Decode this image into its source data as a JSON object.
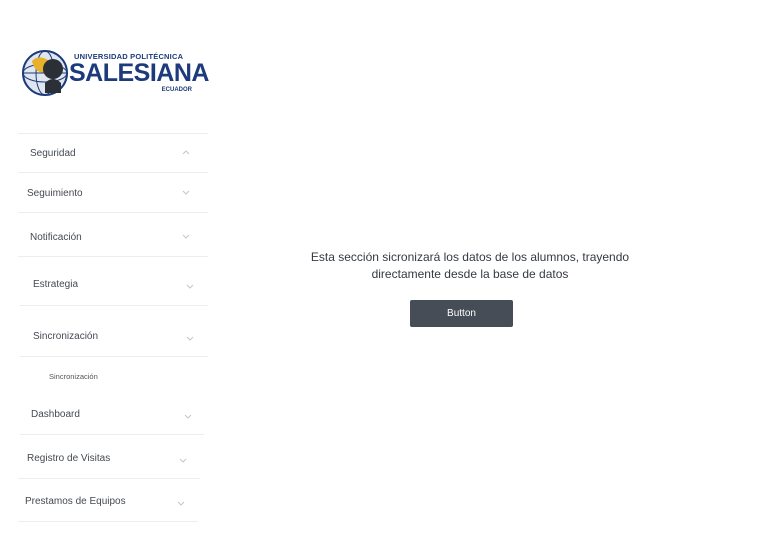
{
  "logo": {
    "line1": "UNIVERSIDAD POLITÉCNICA",
    "line2": "SALESIANA",
    "line3": "ECUADOR"
  },
  "sidebar": {
    "items": [
      {
        "label": "Seguridad",
        "chevron": "chevron-up"
      },
      {
        "label": "Seguimiento",
        "chevron": "chevron-down"
      },
      {
        "label": "Notificación",
        "chevron": "chevron-down"
      },
      {
        "label": "Estrategia",
        "chevron": "chevron-down"
      },
      {
        "label": "Sincronización",
        "chevron": "chevron-down"
      },
      {
        "label": "Dashboard",
        "chevron": "chevron-down"
      },
      {
        "label": "Registro de Visitas",
        "chevron": "chevron-down"
      },
      {
        "label": "Prestamos de Equipos",
        "chevron": "chevron-down"
      }
    ],
    "subitem": "Sincronización"
  },
  "main": {
    "message": "Esta sección sicronizará los datos de los alumnos, trayendo directamente desde la base de datos",
    "button_label": "Button"
  },
  "colors": {
    "brand_blue": "#1d3b7a",
    "button_bg": "#464d56",
    "divider": "#ebedf0"
  }
}
